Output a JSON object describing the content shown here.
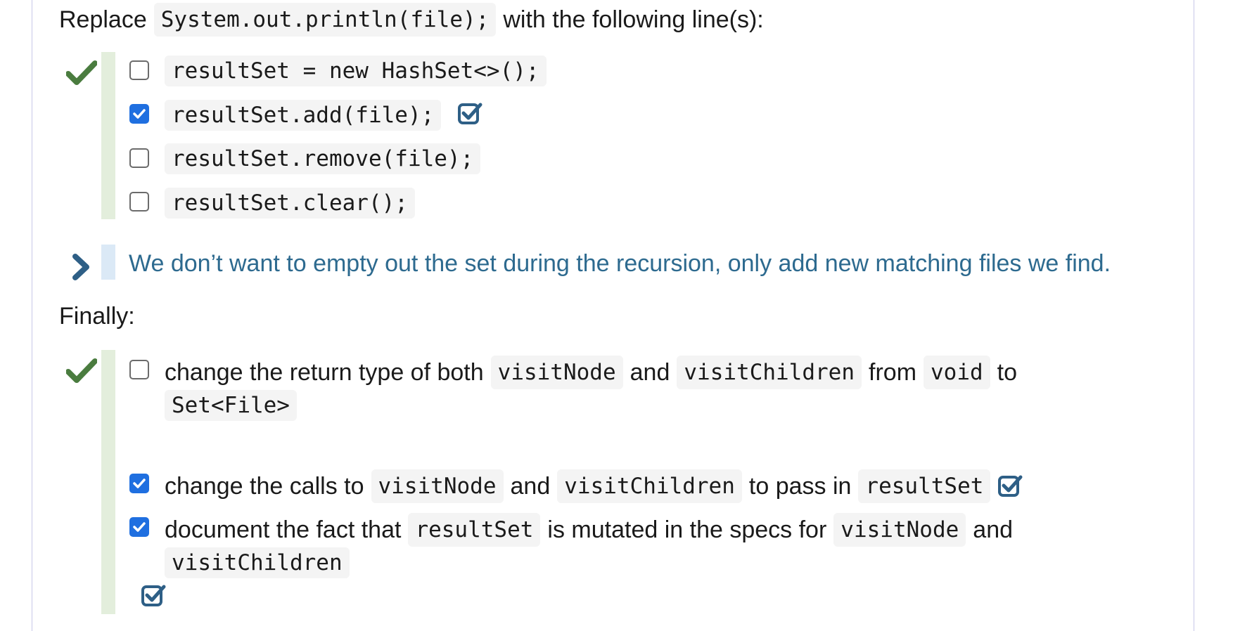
{
  "q1": {
    "prompt_before": "Replace",
    "prompt_code": "System.out.println(file);",
    "prompt_after": "with the following line(s):",
    "options": [
      {
        "code": "resultSet = new HashSet<>();",
        "checked": false
      },
      {
        "code": "resultSet.add(file);",
        "checked": true,
        "correct_marker": true
      },
      {
        "code": "resultSet.remove(file);",
        "checked": false
      },
      {
        "code": "resultSet.clear();",
        "checked": false
      }
    ],
    "explanation": "We don’t want to empty out the set during the recursion, only add new matching files we find."
  },
  "q2": {
    "heading": "Finally:",
    "option1": {
      "t1": "change the return type of both",
      "c1": "visitNode",
      "t2": "and",
      "c2": "visitChildren",
      "t3": "from",
      "c3": "void",
      "t4": "to",
      "c4": "Set<File>",
      "checked": false
    },
    "option2": {
      "t1": "change the calls to",
      "c1": "visitNode",
      "t2": "and",
      "c2": "visitChildren",
      "t3": "to pass in",
      "c3": "resultSet",
      "checked": true
    },
    "option3": {
      "t1": "document the fact that",
      "c1": "resultSet",
      "t2": "is mutated in the specs for",
      "c2": "visitNode",
      "t3": "and",
      "c3": "visitChildren",
      "checked": true
    }
  },
  "colors": {
    "checkmark_green": "#4a7c3f",
    "checkbox_blue": "#1f6fe0",
    "feedback_text": "#2d6a8f",
    "marker_blue": "#2e5f86"
  },
  "icons": {
    "correct": "check-mark-icon",
    "verified": "check-square-icon",
    "expand": "chevron-right-icon"
  }
}
